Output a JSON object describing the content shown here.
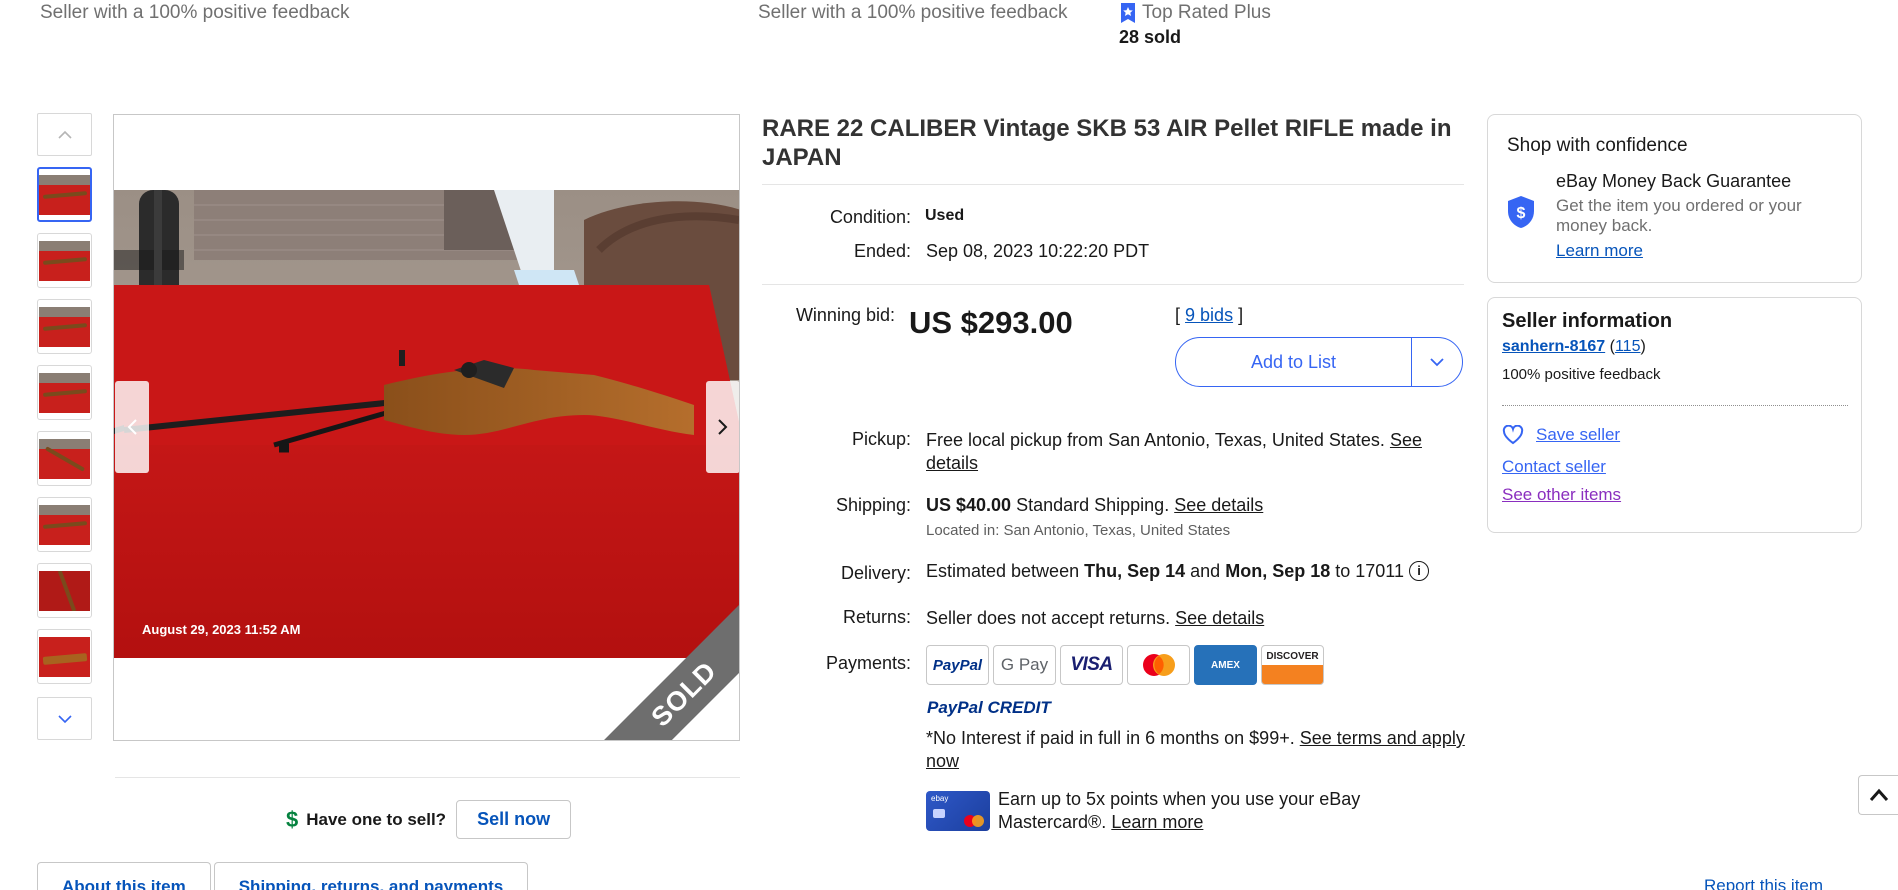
{
  "top": {
    "feedback_left": "Seller with a 100% positive feedback",
    "feedback_middle": "Seller with a 100% positive feedback",
    "top_rated": "Top Rated Plus",
    "sold": "28 sold"
  },
  "gallery": {
    "photo_date": "August 29, 2023 11:52 AM",
    "sold_ribbon": "SOLD",
    "thumb_count": 8
  },
  "sell": {
    "question": "Have one to sell?",
    "button": "Sell now"
  },
  "tabs": [
    {
      "label": "About this item"
    },
    {
      "label": "Shipping, returns, and payments"
    }
  ],
  "report": "Report this item",
  "item": {
    "title": "RARE 22 CALIBER Vintage SKB 53 AIR Pellet RIFLE made in JAPAN",
    "condition_label": "Condition:",
    "condition_value": "Used",
    "ended_label": "Ended:",
    "ended_value": "Sep 08, 2023 10:22:20 PDT",
    "winning_label": "Winning bid:",
    "price": "US $293.00",
    "bids_open": "[",
    "bids_link": "9 bids",
    "bids_close": "]",
    "add_to_list": "Add to List",
    "pickup_label": "Pickup:",
    "pickup_value": "Free local pickup from San Antonio, Texas, United States.",
    "pickup_link": "See details",
    "shipping_label": "Shipping:",
    "shipping_bold": "US $40.00",
    "shipping_value": "Standard Shipping.",
    "shipping_link": "See details",
    "located": "Located in: San Antonio, Texas, United States",
    "delivery_label": "Delivery:",
    "delivery_pre": "Estimated between",
    "delivery_from": "Thu, Sep 14",
    "delivery_and": "and",
    "delivery_to": "Mon, Sep 18",
    "delivery_post": "to 17011",
    "returns_label": "Returns:",
    "returns_value": "Seller does not accept returns.",
    "returns_link": "See details",
    "payments_label": "Payments:",
    "payment_methods": [
      "PayPal",
      "G Pay",
      "VISA",
      "Mastercard",
      "AMEX",
      "DISCOVER"
    ],
    "paypal_credit": "PayPal CREDIT",
    "credit_text": "*No Interest if paid in full in 6 months on $99+.",
    "credit_link": "See terms and apply now",
    "earn_text": "Earn up to 5x points when you use your eBay Mastercard®.",
    "earn_link": "Learn more",
    "card_brand": "ebay"
  },
  "confidence": {
    "heading": "Shop with confidence",
    "guarantee_title": "eBay Money Back Guarantee",
    "guarantee_text": "Get the item you ordered or your money back.",
    "learn_more": "Learn more"
  },
  "seller": {
    "heading": "Seller information",
    "name": "sanhern-8167",
    "score_open": "(",
    "score": "115",
    "score_close": ")",
    "feedback": "100% positive feedback",
    "save": "Save seller",
    "contact": "Contact seller",
    "other": "See other items"
  },
  "colors": {
    "accent": "#3665f3",
    "link": "#0654ba",
    "visited": "#8a2ebf"
  }
}
